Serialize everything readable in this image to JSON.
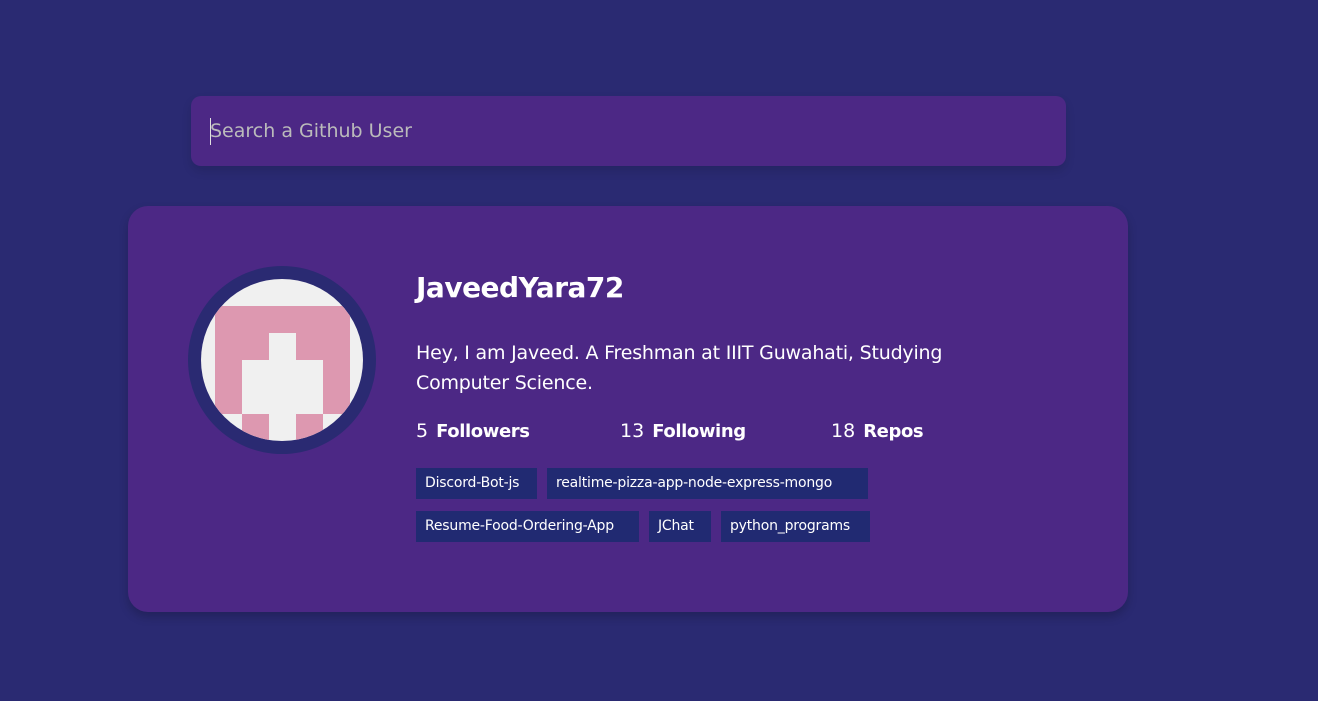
{
  "search": {
    "placeholder": "Search a Github User",
    "value": ""
  },
  "profile": {
    "username": "JaveedYara72",
    "bio": "Hey, I am Javeed. A Freshman at IIIT Guwahati, Studying Computer Science.",
    "stats": {
      "followers_count": "5",
      "followers_label": "Followers",
      "following_count": "13",
      "following_label": "Following",
      "repos_count": "18",
      "repos_label": "Repos"
    },
    "repos": [
      "Discord-Bot-js",
      "realtime-pizza-app-node-express-mongo",
      "Resume-Food-Ordering-App",
      "JChat",
      "python_programs"
    ]
  },
  "colors": {
    "background": "#2a2a72",
    "card": "#4c2885",
    "repo_tag": "#212a72",
    "avatar_pink": "#dd98b0",
    "avatar_bg": "#f0f0f0"
  },
  "icons": {
    "avatar": "identicon-avatar"
  }
}
